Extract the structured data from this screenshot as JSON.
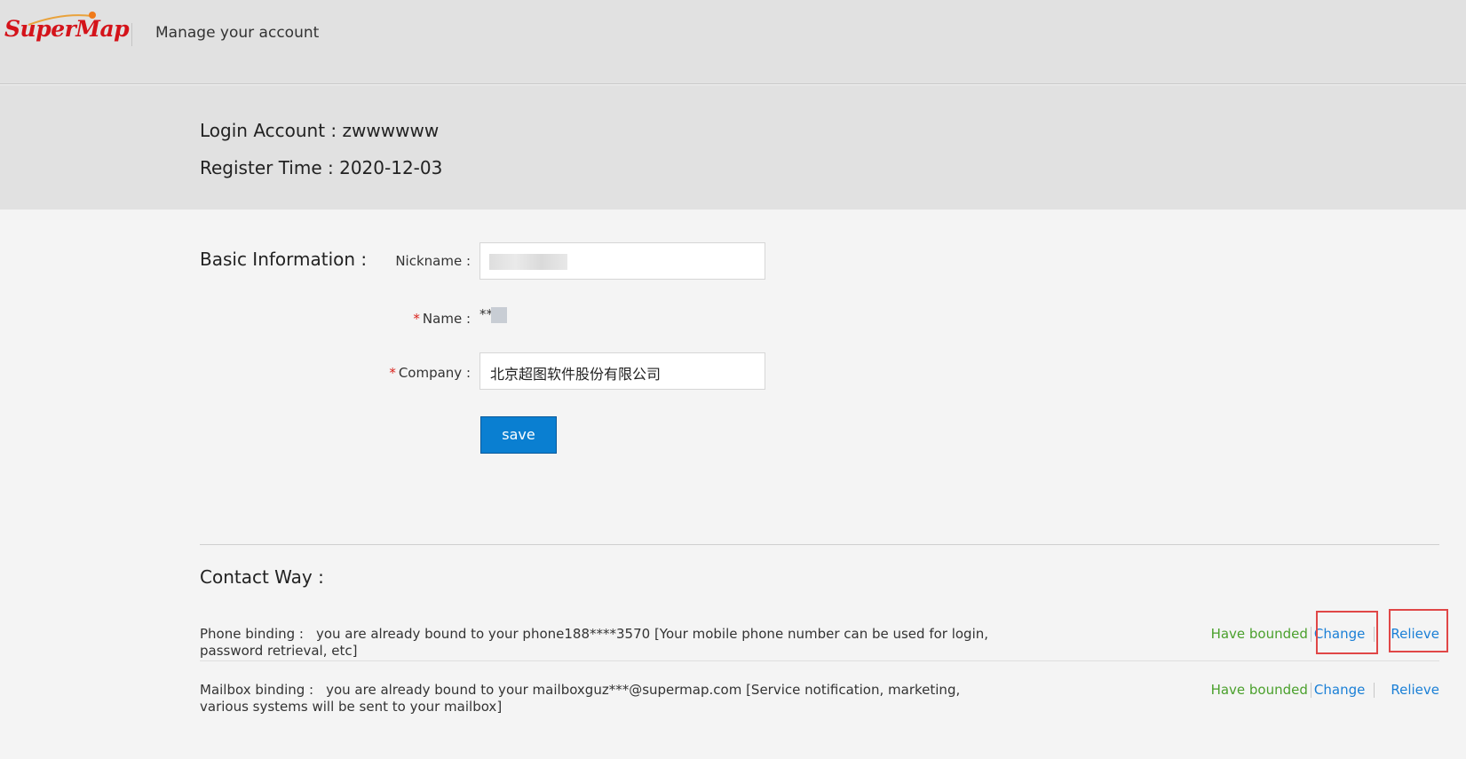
{
  "header": {
    "logo_text": "SuperMap",
    "title": "Manage your account"
  },
  "account": {
    "login_label": "Login Account : ",
    "login_value": "zwwwwww",
    "register_label": "Register Time : ",
    "register_value": "2020-12-03"
  },
  "basic_info": {
    "title": "Basic Information :",
    "nickname_label": "Nickname :",
    "name_label": "Name :",
    "name_value": "**",
    "company_label": "Company :",
    "company_value": "北京超图软件股份有限公司",
    "required_mark": "*",
    "save_label": "save"
  },
  "contact": {
    "title": "Contact Way :",
    "phone": {
      "label": "Phone binding :",
      "text": "you are already bound to your phone188****3570 [Your mobile phone number can be used for login, password retrieval, etc]",
      "status": "Have bounded",
      "change": "Change",
      "relieve": "Relieve"
    },
    "mailbox": {
      "label": "Mailbox binding :",
      "text": "you are already bound to your mailboxguz***@supermap.com [Service notification, marketing, various systems will be sent to your mailbox]",
      "status": "Have bounded",
      "change": "Change",
      "relieve": "Relieve"
    }
  },
  "colors": {
    "brand_red": "#d4131a",
    "primary_blue": "#0a7fd1",
    "link_blue": "#1a7fd6",
    "status_green": "#4aa02c",
    "highlight_red": "#e04747"
  }
}
